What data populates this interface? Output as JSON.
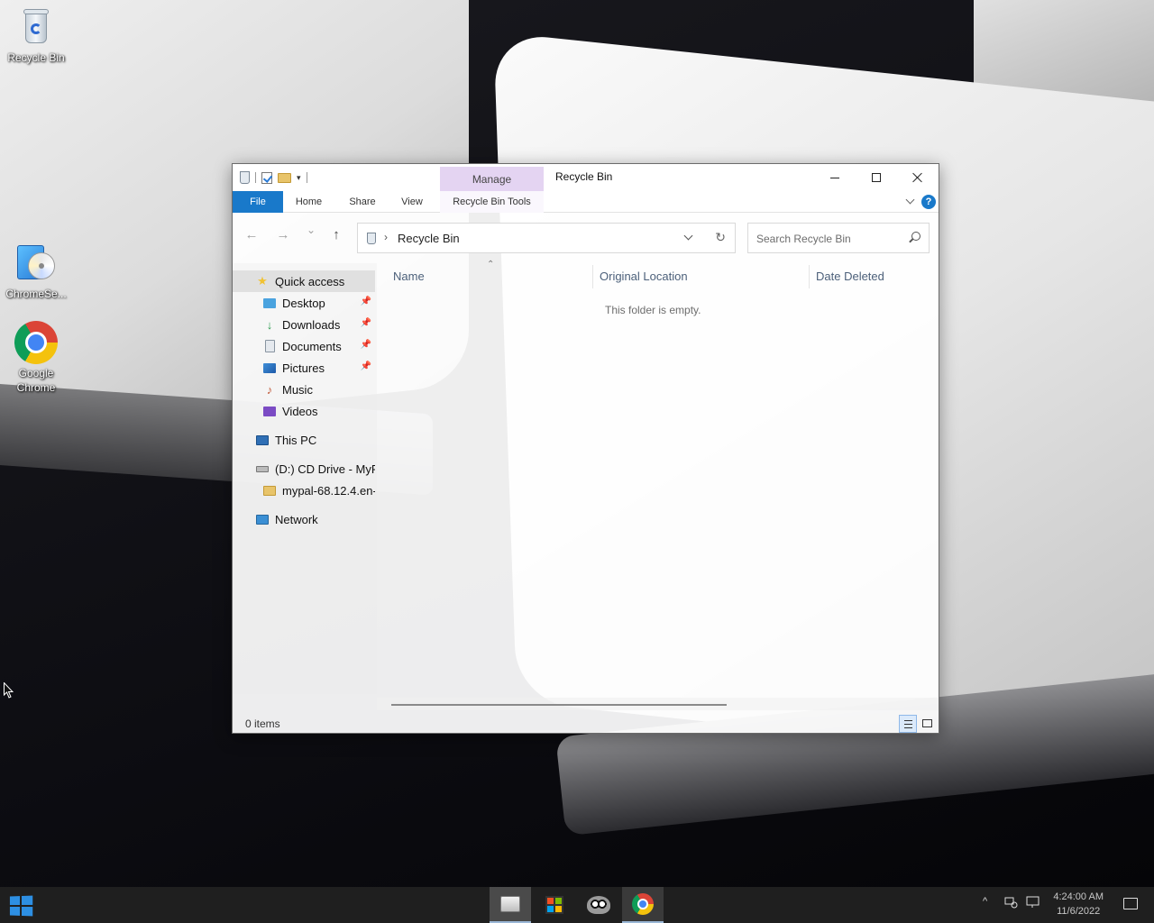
{
  "desktop": {
    "icons": [
      {
        "label": "Recycle Bin",
        "icon": "recycle-bin-icon"
      },
      {
        "label": "ChromeSe...",
        "icon": "chrome-setup-disc-icon"
      },
      {
        "label": "Google Chrome",
        "icon": "google-chrome-icon"
      }
    ]
  },
  "window": {
    "title": "Recycle Bin",
    "context_tab_group": "Manage",
    "ribbon_tabs": {
      "file": "File",
      "home": "Home",
      "share": "Share",
      "view": "View",
      "tools": "Recycle Bin Tools"
    },
    "help": "?",
    "address": {
      "separator": "›",
      "location": "Recycle Bin"
    },
    "search": {
      "placeholder": "Search Recycle Bin"
    },
    "nav": {
      "back": "←",
      "forward": "→",
      "recent": "⌄",
      "up": "↑",
      "refresh": "↻"
    },
    "sidebar": {
      "items": [
        {
          "label": "Quick access",
          "icon": "star-icon",
          "pinned": false
        },
        {
          "label": "Desktop",
          "icon": "desktop-folder-icon",
          "pinned": true
        },
        {
          "label": "Downloads",
          "icon": "download-icon",
          "pinned": true
        },
        {
          "label": "Documents",
          "icon": "documents-icon",
          "pinned": true
        },
        {
          "label": "Pictures",
          "icon": "pictures-icon",
          "pinned": true
        },
        {
          "label": "Music",
          "icon": "music-icon",
          "pinned": false
        },
        {
          "label": "Videos",
          "icon": "videos-icon",
          "pinned": false
        },
        {
          "label": "This PC",
          "icon": "computer-icon",
          "pinned": false
        },
        {
          "label": "(D:) CD Drive - MyP",
          "icon": "cd-drive-icon",
          "pinned": false
        },
        {
          "label": "mypal-68.12.4.en-",
          "icon": "folder-icon",
          "pinned": false
        },
        {
          "label": "Network",
          "icon": "network-icon",
          "pinned": false
        }
      ]
    },
    "columns": [
      "Name",
      "Original Location",
      "Date Deleted"
    ],
    "empty_message": "This folder is empty.",
    "status": {
      "item_count": "0 items"
    }
  },
  "taskbar": {
    "apps": [
      "file-explorer-icon",
      "store-icon",
      "mypal-icon",
      "google-chrome-icon"
    ],
    "tray": {
      "chevron": "^",
      "time": "4:24:00 AM",
      "date": "11/6/2022"
    }
  },
  "colors": {
    "file_tab": "#1979ca",
    "manage_tab": "#e4d4f2",
    "taskbar": "#1f1f1f",
    "start": "#2d8fe3"
  }
}
